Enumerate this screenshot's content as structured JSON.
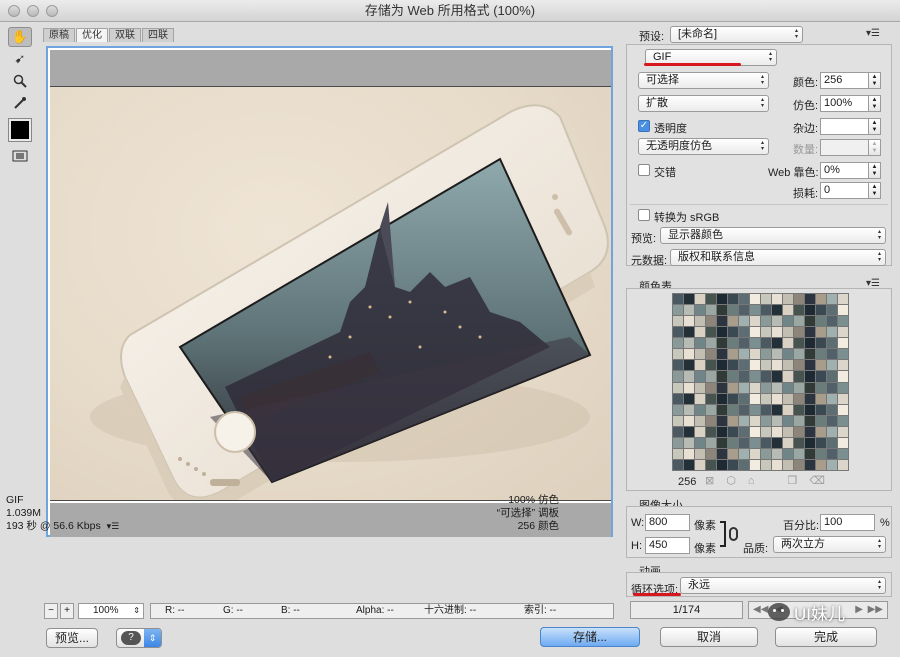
{
  "window": {
    "title": "存储为 Web 所用格式 (100%)"
  },
  "view_tabs": [
    "原稿",
    "优化",
    "双联",
    "四联"
  ],
  "canvas_info": {
    "left": [
      "GIF",
      "1.039M",
      "193 秒 @ 56.6 Kbps"
    ],
    "right": [
      "100% 仿色",
      "“可选择” 调板",
      "256 颜色"
    ]
  },
  "status_bar": {
    "zoom": "100%",
    "r": "R: --",
    "g": "G: --",
    "b": "B: --",
    "alpha": "Alpha: --",
    "hex": "十六进制: --",
    "index": "索引: --"
  },
  "buttons": {
    "preview": "预览...",
    "save": "存储...",
    "cancel": "取消",
    "done": "完成"
  },
  "settings": {
    "preset_label": "预设:",
    "preset_value": "[未命名]",
    "format": "GIF",
    "reduction": "可选择",
    "dither_algo": "扩散",
    "transparency": "透明度",
    "transparency_dither": "无透明度仿色",
    "interlaced": "交错",
    "colors_label": "颜色:",
    "colors_value": "256",
    "dither_label": "仿色:",
    "dither_value": "100%",
    "matte_label": "杂边:",
    "amount_label": "数量:",
    "web_snap_label": "Web 靠色:",
    "web_snap_value": "0%",
    "lossy_label": "损耗:",
    "lossy_value": "0",
    "convert_srgb": "转换为 sRGB",
    "preview_label": "预览:",
    "preview_value": "显示器颜色",
    "metadata_label": "元数据:",
    "metadata_value": "版权和联系信息"
  },
  "color_table": {
    "title": "颜色表",
    "count": "256"
  },
  "image_size": {
    "title": "图像大小",
    "w_label": "W:",
    "w_value": "800",
    "h_label": "H:",
    "h_value": "450",
    "unit": "像素",
    "percent_label": "百分比:",
    "percent_value": "100",
    "percent_unit": "%",
    "quality_label": "品质:",
    "quality_value": "两次立方"
  },
  "animation": {
    "title": "动画",
    "loop_label": "循环选项:",
    "loop_value": "永远",
    "frame": "1/174"
  },
  "watermark": "UI妹儿",
  "colors": {
    "accent": "#6fa4de",
    "annotation": "#d7171f",
    "primary_button": "#6eaaf2"
  }
}
